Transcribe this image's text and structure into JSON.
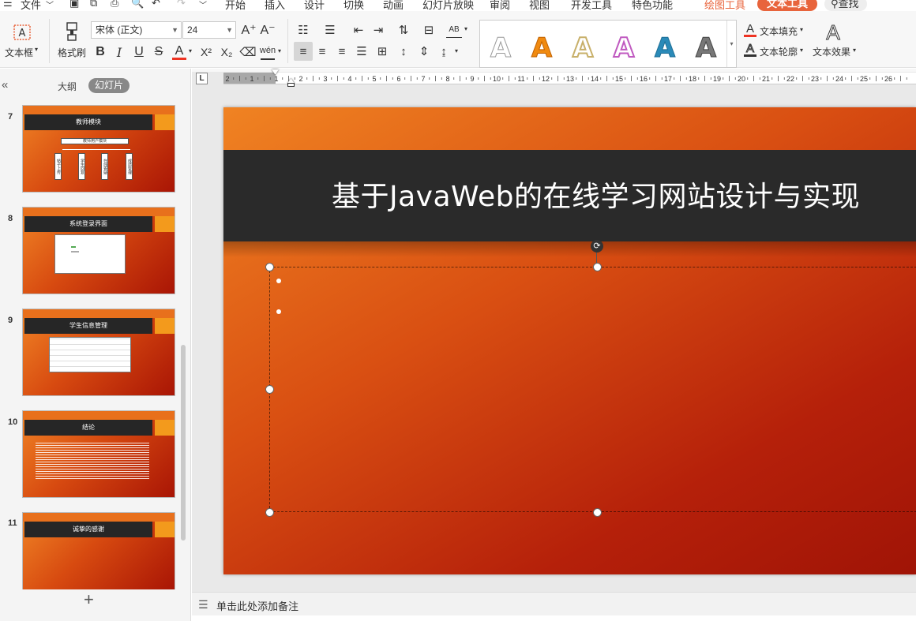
{
  "menu": {
    "file": "文件",
    "tabs": [
      "开始",
      "插入",
      "设计",
      "切换",
      "动画",
      "幻灯片放映",
      "审阅",
      "视图",
      "开发工具",
      "特色功能"
    ],
    "drawing_tools": "绘图工具",
    "text_tools": "文本工具",
    "search": "查找"
  },
  "ribbon": {
    "textbox": "文本框",
    "format_painter": "格式刷",
    "font_name": "宋体 (正文)",
    "font_size": "24",
    "text_fill": "文本填充",
    "text_outline": "文本轮廓",
    "text_effects": "文本效果",
    "bold": "B",
    "italic": "I",
    "underline": "U",
    "strike": "S",
    "font_color": "A",
    "superscript": "X²",
    "subscript": "X₂",
    "grow_font": "A⁺",
    "shrink_font": "A⁻",
    "pinyin": "wén",
    "art_letter": "A",
    "effect_letter": "A",
    "char_spacing": "AB"
  },
  "leftpanel": {
    "tab_outline": "大纲",
    "tab_slides": "幻灯片",
    "collapse": "«",
    "add": "+",
    "slides": [
      {
        "num": "7",
        "title": "教师模块",
        "subtitle": "教师用户模块",
        "items": [
          "帖子上传",
          "学生回复",
          "在线答疑",
          "成绩管理"
        ]
      },
      {
        "num": "8",
        "title": "系统登录界面"
      },
      {
        "num": "9",
        "title": "学生信息管理"
      },
      {
        "num": "10",
        "title": "结论"
      },
      {
        "num": "11",
        "title": "诚挚的感谢"
      }
    ]
  },
  "ruler": {
    "labels": [
      "2",
      "1",
      "1",
      "2",
      "3",
      "4",
      "5",
      "6",
      "7",
      "8",
      "9",
      "10",
      "11",
      "12",
      "13",
      "14",
      "15",
      "16",
      "17",
      "18",
      "19",
      "20",
      "21",
      "22",
      "23",
      "24",
      "25",
      "26"
    ],
    "tab_stop": "L"
  },
  "slide": {
    "title": "基于JavaWeb的在线学习网站设计与实现"
  },
  "notes": {
    "placeholder": "单击此处添加备注"
  },
  "colors": {
    "accent": "#e8643c",
    "title_bar": "#2a2a2a",
    "slide_orange": "#f08322",
    "slide_red": "#a01406",
    "square_orange": "#f39a1c"
  }
}
